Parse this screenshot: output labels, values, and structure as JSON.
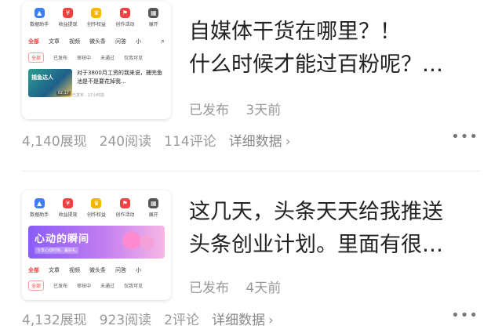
{
  "posts": [
    {
      "thumb": {
        "quick_items": [
          {
            "label": "数据助手",
            "icon": "chart-icon",
            "color": "#3d7ff3",
            "glyph": "▲"
          },
          {
            "label": "收益提现",
            "icon": "yen-icon",
            "color": "#f04142",
            "glyph": "¥"
          },
          {
            "label": "创作权益",
            "icon": "crown-icon",
            "color": "#f5b700",
            "glyph": "♛"
          },
          {
            "label": "创作活动",
            "icon": "flag-icon",
            "color": "#f04142",
            "glyph": "⚑"
          },
          {
            "label": "展开",
            "icon": "grid-icon",
            "color": "#555555",
            "glyph": "▦"
          }
        ],
        "tabs": [
          "全部",
          "文章",
          "视频",
          "微头条",
          "问答",
          "小"
        ],
        "filters": [
          "全部",
          "已发布",
          "审核中",
          "未通过",
          "仅我可见"
        ],
        "mini_article": {
          "image_text": "捕鱼达人",
          "image_badge": "02:17",
          "text": "对于3800月工资的我来说，捕完鱼池是不是要花掉我...",
          "meta": "已发布 · 17小时前"
        }
      },
      "title_lines": [
        "自媒体干货在哪里？！",
        "什么时候才能过百粉呢？…"
      ],
      "status": "已发布",
      "time": "3天前",
      "stats": {
        "views": "4,140展现",
        "reads": "240阅读",
        "comments": "114评论",
        "detail": "详细数据"
      }
    },
    {
      "thumb": {
        "quick_items": [
          {
            "label": "数据助手",
            "icon": "chart-icon",
            "color": "#3d7ff3",
            "glyph": "▲"
          },
          {
            "label": "收益提现",
            "icon": "yen-icon",
            "color": "#f04142",
            "glyph": "¥"
          },
          {
            "label": "创作权益",
            "icon": "crown-icon",
            "color": "#f5b700",
            "glyph": "♛"
          },
          {
            "label": "创作活动",
            "icon": "flag-icon",
            "color": "#f04142",
            "glyph": "⚑"
          },
          {
            "label": "展开",
            "icon": "grid-icon",
            "color": "#555555",
            "glyph": "▦"
          }
        ],
        "banner": {
          "title": "心动的瞬间",
          "subtitle": "分享心动时刻，赢好礼"
        },
        "tabs": [
          "全部",
          "文章",
          "视频",
          "微头条",
          "问答",
          "小"
        ],
        "filters": [
          "全部",
          "已发布",
          "审核中",
          "未通过",
          "仅我可见"
        ]
      },
      "title_lines": [
        "这几天，头条天天给我推送",
        "头条创业计划。里面有很…"
      ],
      "status": "已发布",
      "time": "4天前",
      "stats": {
        "views": "4,132展现",
        "reads": "923阅读",
        "comments": "2评论",
        "detail": "详细数据"
      }
    }
  ],
  "icons": {
    "search": "search-icon",
    "more": "more-icon",
    "chevron": "chevron-right-icon"
  },
  "colors": {
    "accent": "#f04142",
    "muted": "#999999",
    "text": "#222222"
  }
}
